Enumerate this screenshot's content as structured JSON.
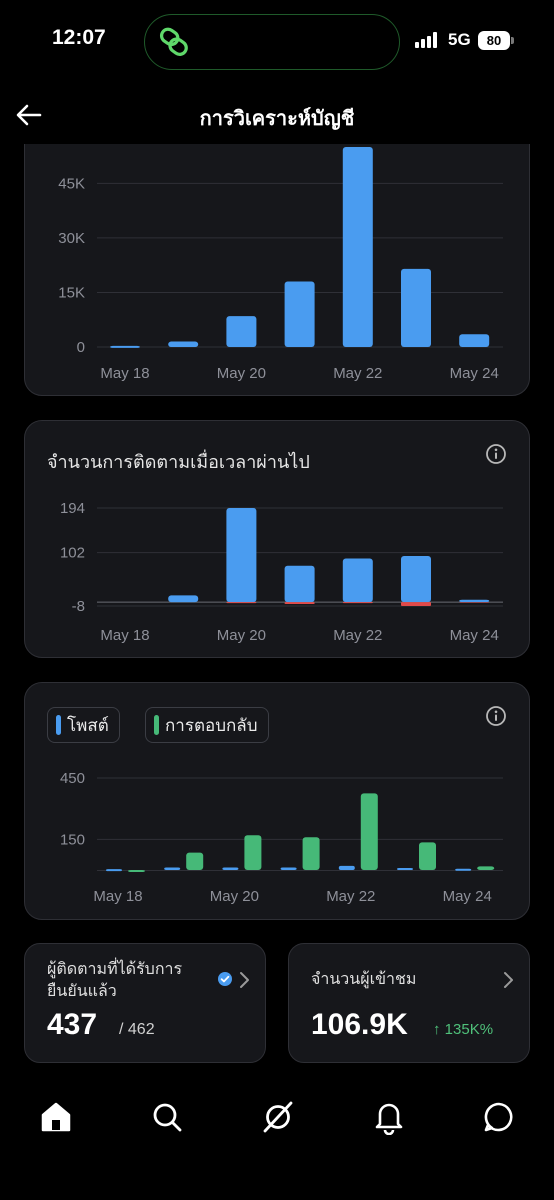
{
  "status": {
    "time": "12:07",
    "network": "5G",
    "battery": "80"
  },
  "header": {
    "title": "การวิเคราะห์บัญชี"
  },
  "colors": {
    "blue": "#4a9cf0",
    "green": "#46b978",
    "red": "#e14a4a"
  },
  "icons": {
    "back": "arrow-left-icon",
    "info": "info-icon",
    "verified": "verified-badge-icon",
    "chevron": "chevron-right-icon",
    "nav": [
      "home-icon",
      "search-icon",
      "explore-icon",
      "bell-icon",
      "chat-icon"
    ]
  },
  "chart_data": [
    {
      "type": "bar",
      "title": "",
      "categories": [
        "May 18",
        "May 19",
        "May 20",
        "May 21",
        "May 22",
        "May 23",
        "May 24"
      ],
      "values": [
        300,
        1500,
        8500,
        18000,
        55000,
        21500,
        3500
      ],
      "y_ticks": [
        "0",
        "15K",
        "30K",
        "45K"
      ],
      "y_tick_values": [
        0,
        15000,
        30000,
        45000
      ],
      "x_tick_labels": [
        "May 18",
        "",
        "May 20",
        "",
        "May 22",
        "",
        "May 24"
      ],
      "ylim": [
        0,
        55000
      ],
      "grid": true
    },
    {
      "type": "bar",
      "title": "จำนวนการติดตามเมื่อเวลาผ่านไป",
      "categories": [
        "May 18",
        "May 19",
        "May 20",
        "May 21",
        "May 22",
        "May 23",
        "May 24"
      ],
      "series": [
        {
          "values": [
            0,
            14,
            194,
            75,
            90,
            95,
            5
          ]
        },
        {
          "values": [
            0,
            0,
            -2,
            -4,
            -2,
            -8,
            -1
          ]
        }
      ],
      "y_ticks": [
        "194",
        "102",
        "-8"
      ],
      "y_tick_values": [
        194,
        102,
        -8
      ],
      "x_tick_labels": [
        "May 18",
        "",
        "May 20",
        "",
        "May 22",
        "",
        "May 24"
      ],
      "ylim": [
        -8,
        194
      ],
      "grid": true
    },
    {
      "type": "bar",
      "title": "",
      "categories": [
        "May 18",
        "May 19",
        "May 20",
        "May 21",
        "May 22",
        "May 23",
        "May 24"
      ],
      "series": [
        {
          "name": "โพสต์",
          "values": [
            4,
            12,
            12,
            12,
            20,
            10,
            6
          ]
        },
        {
          "name": "การตอบกลับ",
          "values": [
            0,
            85,
            170,
            160,
            375,
            135,
            18
          ]
        }
      ],
      "y_ticks": [
        "150",
        "450"
      ],
      "y_tick_values": [
        150,
        450
      ],
      "x_tick_labels": [
        "May 18",
        "",
        "May 20",
        "",
        "May 22",
        "",
        "May 24"
      ],
      "ylim": [
        0,
        450
      ],
      "grid": true
    }
  ],
  "legend": {
    "posts": "โพสต์",
    "replies": "การตอบกลับ"
  },
  "stats": {
    "verified_followers": {
      "label_line1": "ผู้ติดตามที่ได้รับการ",
      "label_line2": "ยืนยันแล้ว",
      "value": "437",
      "total": "/ 462"
    },
    "viewers": {
      "label": "จำนวนผู้เข้าชม",
      "value": "106.9K",
      "delta": "↑ 135K%"
    }
  }
}
